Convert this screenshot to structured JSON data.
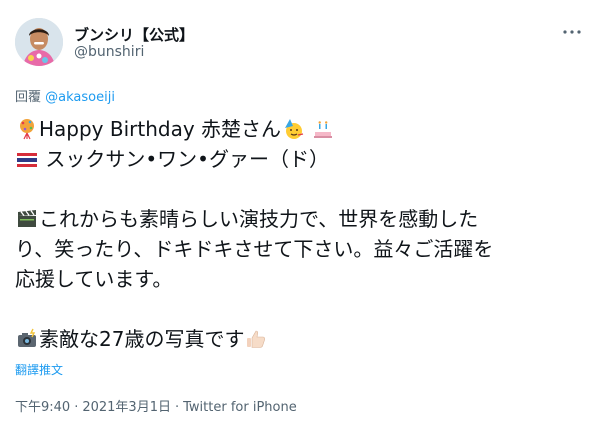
{
  "author": {
    "display_name": "ブンシリ【公式】",
    "handle": "@bunshiri"
  },
  "reply": {
    "prefix": "回覆",
    "mention": "@akasoeiji"
  },
  "tweet": {
    "line1_a": "Happy Birthday  赤楚さん",
    "line2_a": " スックサン•ワン•グァー（ド）",
    "line3_a": "これからも素晴らしい演技力で、世界を感動した",
    "line4": "り、笑ったり、ドキドキさせて下さい。益々ご活躍を",
    "line5": "応援しています。",
    "line6_a": "素敵な27歳の写真です",
    "icons": [
      "confetti-ball-icon",
      "partying-face-icon",
      "birthday-cake-icon",
      "thailand-flag-icon",
      "clapper-board-icon",
      "camera-flash-icon",
      "thumbs-up-icon"
    ]
  },
  "translate_label": "翻譯推文",
  "meta": {
    "time": "下午9:40",
    "separator": "·",
    "date": "2021年3月1日",
    "source": "Twitter for iPhone"
  },
  "colors": {
    "text": "#0f1419",
    "secondary": "#536471",
    "link": "#1d9bf0"
  }
}
